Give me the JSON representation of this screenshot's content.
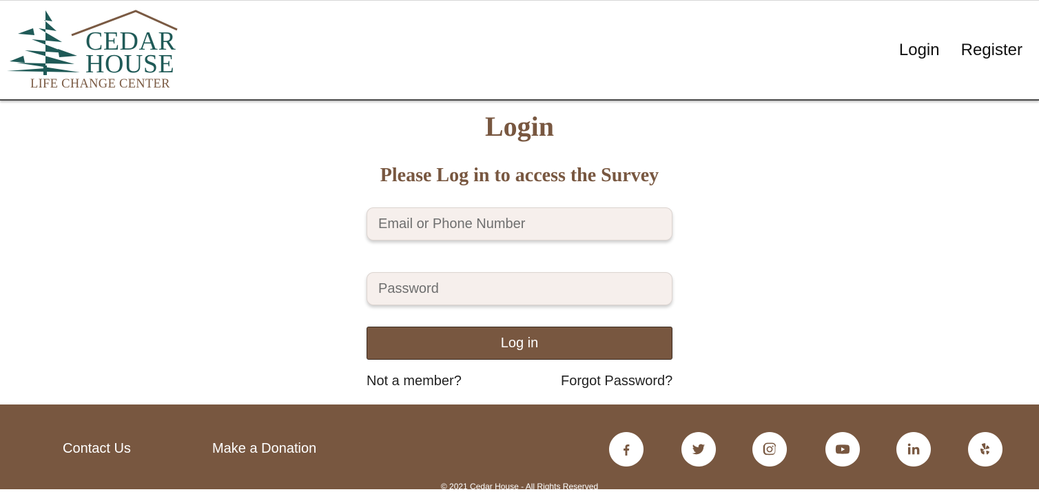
{
  "header": {
    "logo": {
      "line1": "CEDAR",
      "line2": "HOUSE",
      "tagline": "LIFE CHANGE CENTER"
    },
    "nav": [
      {
        "label": "Login"
      },
      {
        "label": "Register"
      }
    ]
  },
  "main": {
    "title": "Login",
    "subtitle": "Please Log in to access the Survey",
    "email_placeholder": "Email or Phone Number",
    "password_placeholder": "Password",
    "submit_label": "Log in",
    "not_member_label": "Not a member?",
    "forgot_label": "Forgot Password?"
  },
  "footer": {
    "contact_label": "Contact Us",
    "donate_label": "Make a Donation",
    "social": [
      {
        "icon": "facebook-icon"
      },
      {
        "icon": "twitter-icon"
      },
      {
        "icon": "instagram-icon"
      },
      {
        "icon": "youtube-icon"
      },
      {
        "icon": "linkedin-icon"
      },
      {
        "icon": "yelp-icon"
      }
    ],
    "copyright": "© 2021 Cedar House - All Rights Reserved"
  },
  "colors": {
    "brand_brown": "#785740",
    "logo_green": "#1f5a57",
    "input_bg": "#f6efec"
  }
}
